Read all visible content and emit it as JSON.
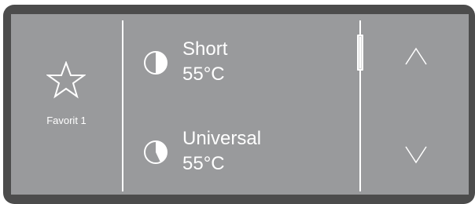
{
  "colors": {
    "bezel": "#4c4c4c",
    "screen": "#999a9c",
    "foreground": "#ffffff"
  },
  "favorite": {
    "icon": "star-icon",
    "label": "Favorit 1"
  },
  "programs": [
    {
      "name": "Short",
      "temperature": "55°C",
      "icon": "pie-clock-icon",
      "remaining_fraction": 0.5
    },
    {
      "name": "Universal",
      "temperature": "55°C",
      "icon": "pie-clock-icon",
      "remaining_fraction": 0.6
    }
  ],
  "scroll": {
    "position_fraction": 0.0
  },
  "navigation": {
    "up_icon": "chevron-up-icon",
    "down_icon": "chevron-down-icon"
  }
}
